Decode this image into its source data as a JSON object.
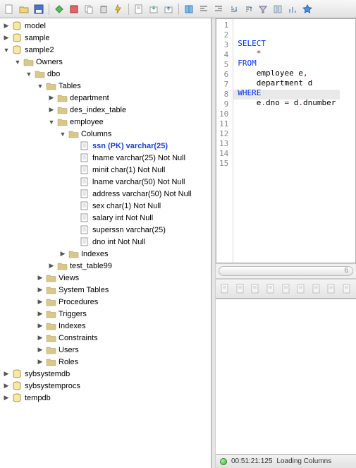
{
  "toolbar": {
    "icons": [
      "new-icon",
      "open-icon",
      "save-icon",
      "sep",
      "connect-icon",
      "disconnect-icon",
      "copy-icon",
      "delete-icon",
      "bolt-icon",
      "sep",
      "doc-icon",
      "export-icon",
      "import-icon",
      "sep",
      "book-icon",
      "align-left-icon",
      "align-right-icon",
      "sort-asc-icon",
      "sort-desc-icon",
      "filter-icon",
      "columns-icon",
      "bar-icon",
      "star-icon"
    ]
  },
  "tree": [
    {
      "d": 0,
      "t": "right",
      "i": "db",
      "l": "model"
    },
    {
      "d": 0,
      "t": "right",
      "i": "db",
      "l": "sample"
    },
    {
      "d": 0,
      "t": "down",
      "i": "db",
      "l": "sample2"
    },
    {
      "d": 1,
      "t": "down",
      "i": "folder",
      "l": "Owners"
    },
    {
      "d": 2,
      "t": "down",
      "i": "folder",
      "l": "dbo"
    },
    {
      "d": 3,
      "t": "down",
      "i": "folder",
      "l": "Tables"
    },
    {
      "d": 4,
      "t": "right",
      "i": "folder",
      "l": "department"
    },
    {
      "d": 4,
      "t": "right",
      "i": "folder",
      "l": "des_index_table"
    },
    {
      "d": 4,
      "t": "down",
      "i": "folder",
      "l": "employee"
    },
    {
      "d": 5,
      "t": "down",
      "i": "folder",
      "l": "Columns"
    },
    {
      "d": 6,
      "t": "",
      "i": "file",
      "l": "ssn (PK) varchar(25)",
      "pk": true
    },
    {
      "d": 6,
      "t": "",
      "i": "file",
      "l": "fname varchar(25) Not Null"
    },
    {
      "d": 6,
      "t": "",
      "i": "file",
      "l": "minit char(1) Not Null"
    },
    {
      "d": 6,
      "t": "",
      "i": "file",
      "l": "lname varchar(50) Not Null"
    },
    {
      "d": 6,
      "t": "",
      "i": "file",
      "l": "address varchar(50) Not Null"
    },
    {
      "d": 6,
      "t": "",
      "i": "file",
      "l": "sex char(1) Not Null"
    },
    {
      "d": 6,
      "t": "",
      "i": "file",
      "l": "salary int Not Null"
    },
    {
      "d": 6,
      "t": "",
      "i": "file",
      "l": "superssn varchar(25)"
    },
    {
      "d": 6,
      "t": "",
      "i": "file",
      "l": "dno int Not Null"
    },
    {
      "d": 5,
      "t": "right",
      "i": "folder",
      "l": "Indexes"
    },
    {
      "d": 4,
      "t": "right",
      "i": "folder",
      "l": "test_table99"
    },
    {
      "d": 3,
      "t": "right",
      "i": "folder",
      "l": "Views"
    },
    {
      "d": 3,
      "t": "right",
      "i": "folder",
      "l": "System Tables"
    },
    {
      "d": 3,
      "t": "right",
      "i": "folder",
      "l": "Procedures"
    },
    {
      "d": 3,
      "t": "right",
      "i": "folder",
      "l": "Triggers"
    },
    {
      "d": 3,
      "t": "right",
      "i": "folder",
      "l": "Indexes"
    },
    {
      "d": 3,
      "t": "right",
      "i": "folder",
      "l": "Constraints"
    },
    {
      "d": 3,
      "t": "right",
      "i": "folder",
      "l": "Users"
    },
    {
      "d": 3,
      "t": "right",
      "i": "folder",
      "l": "Roles"
    },
    {
      "d": 0,
      "t": "right",
      "i": "db",
      "l": "sybsystemdb"
    },
    {
      "d": 0,
      "t": "right",
      "i": "db",
      "l": "sybsystemprocs"
    },
    {
      "d": 0,
      "t": "right",
      "i": "db",
      "l": "tempdb"
    }
  ],
  "editor": {
    "lineCount": 15,
    "currentLine": 8,
    "lines": [
      {
        "n": 1,
        "seg": [
          {
            "c": "kw",
            "t": "SELECT"
          }
        ]
      },
      {
        "n": 2,
        "seg": [
          {
            "c": "",
            "t": "    "
          },
          {
            "c": "op",
            "t": "*"
          }
        ]
      },
      {
        "n": 3,
        "seg": [
          {
            "c": "kw",
            "t": "FROM"
          }
        ]
      },
      {
        "n": 4,
        "seg": [
          {
            "c": "",
            "t": "    employee e"
          },
          {
            "c": "op",
            "t": ","
          }
        ]
      },
      {
        "n": 5,
        "seg": [
          {
            "c": "",
            "t": "    department d"
          }
        ]
      },
      {
        "n": 6,
        "seg": [
          {
            "c": "kw",
            "t": "WHERE"
          }
        ]
      },
      {
        "n": 7,
        "seg": [
          {
            "c": "",
            "t": "    e"
          },
          {
            "c": "op",
            "t": "."
          },
          {
            "c": "",
            "t": "dno "
          },
          {
            "c": "op",
            "t": "="
          },
          {
            "c": "",
            "t": " d"
          },
          {
            "c": "op",
            "t": "."
          },
          {
            "c": "",
            "t": "dnumber"
          }
        ]
      },
      {
        "n": 8,
        "seg": []
      },
      {
        "n": 9,
        "seg": []
      },
      {
        "n": 10,
        "seg": []
      },
      {
        "n": 11,
        "seg": []
      },
      {
        "n": 12,
        "seg": []
      },
      {
        "n": 13,
        "seg": []
      },
      {
        "n": 14,
        "seg": []
      },
      {
        "n": 15,
        "seg": []
      }
    ]
  },
  "ruler": {
    "pos": "6"
  },
  "midToolbar": {
    "icons": [
      "rs-first-icon",
      "rs-prev-icon",
      "rs-row-icon",
      "rs-next-icon",
      "rs-last-icon",
      "rs-add-icon",
      "rs-remove-icon",
      "rs-copy-icon",
      "rs-paste-icon"
    ]
  },
  "status": {
    "time": "00:51:21:125",
    "msg": "Loading Columns"
  }
}
